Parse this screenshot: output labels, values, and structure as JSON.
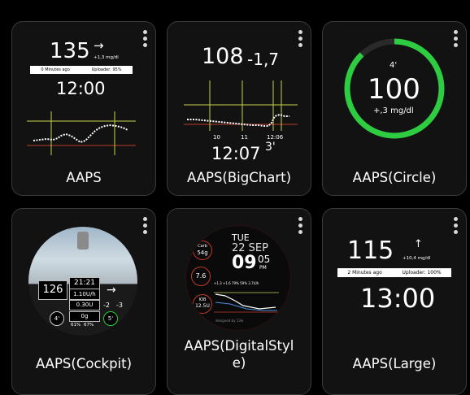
{
  "cards": [
    {
      "label": "AAPS",
      "preview": {
        "bg": "135",
        "arrow": "→",
        "delta": "+1,3 mg/dl",
        "ago": "0 Minutes ago",
        "uploader": "Uploader: 95%",
        "time": "12:00"
      }
    },
    {
      "label": "AAPS(BigChart)",
      "preview": {
        "bg": "108",
        "delta": "-1,7",
        "ticks": [
          "10",
          "11",
          "12:06"
        ],
        "time": "12:07",
        "ago": "3'"
      }
    },
    {
      "label": "AAPS(Circle)",
      "preview": {
        "ago": "4'",
        "bg": "100",
        "delta": "+,3 mg/dl"
      }
    },
    {
      "label": "AAPS(Cockpit)",
      "preview": {
        "bg": "126",
        "time": "21:21",
        "basal": "1.10U/h",
        "iob": "0.30U",
        "arrow": "→",
        "delta_a": "-2",
        "delta_b": "-3",
        "ago": "4'",
        "cob": "0g",
        "ago2": "5'",
        "pct_a": "61%",
        "pct_b": "67%"
      }
    },
    {
      "label": "AAPS(DigitalStyl",
      "label2": "e)",
      "preview": {
        "day": "TUE",
        "date": "22 SEP",
        "hour": "09",
        "minute": "05",
        "ampm": "PM",
        "carbs_label": "Carb",
        "carbs": "54g",
        "delta": "7.6",
        "iob_label": "IOB",
        "iob": "12.5U",
        "status": "+1.3 +1.6  79%  59%  3.7U/h",
        "footer": "designed by 13lo"
      }
    },
    {
      "label": "AAPS(Large)",
      "preview": {
        "bg": "115",
        "arrow": "↑",
        "delta": "+10,4 mg/dl",
        "ago": "2 Minutes ago",
        "uploader": "Uploader: 100%",
        "time": "13:00"
      }
    }
  ],
  "colors": {
    "card_bg": "#121212",
    "card_border": "#3a3a3a",
    "target_line": "#c8d24a",
    "low_line": "#c0392b",
    "circle_green": "#2ecc40",
    "graph_white": "#ffffff"
  },
  "icons": [
    "more-vert-icon"
  ]
}
